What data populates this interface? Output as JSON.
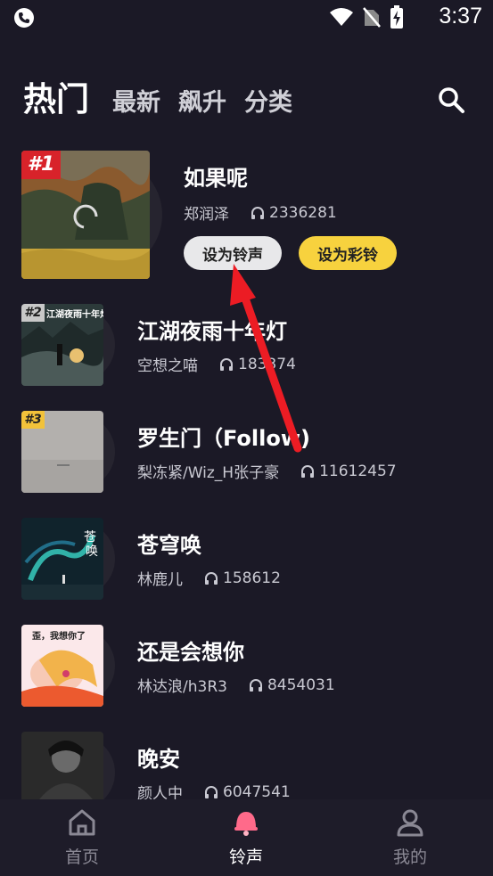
{
  "status": {
    "time": "3:37"
  },
  "header": {
    "tabs": [
      {
        "label": "热门"
      },
      {
        "label": "最新"
      },
      {
        "label": "飙升"
      },
      {
        "label": "分类"
      }
    ]
  },
  "list": [
    {
      "rank": "#1",
      "title": "如果呢",
      "artist": "郑润泽",
      "plays": "2336281",
      "ring_label": "设为铃声",
      "color_label": "设为彩铃"
    },
    {
      "rank": "#2",
      "title": "江湖夜雨十年灯",
      "artist": "空想之喵",
      "plays": "183374"
    },
    {
      "rank": "#3",
      "title": "罗生门（Follow)",
      "artist": "梨冻紧/Wiz_H张子豪",
      "plays": "11612457"
    },
    {
      "title": "苍穹唤",
      "artist": "林鹿儿",
      "plays": "158612"
    },
    {
      "title": "还是会想你",
      "artist": "林达浪/h3R3",
      "plays": "8454031"
    },
    {
      "title": "晚安",
      "artist": "颜人中",
      "plays": "6047541"
    }
  ],
  "tabbar": {
    "items": [
      {
        "label": "首页"
      },
      {
        "label": "铃声"
      },
      {
        "label": "我的"
      }
    ]
  },
  "colors": {
    "accent_active": "#ff6a8a",
    "button_yellow": "#f7d23e",
    "background": "#1b1926",
    "rank_badge_red": "#d8232a"
  },
  "cover_art": {
    "cover2_text": "江湖夜雨十年灯",
    "cover5_text": "歪，我想你了"
  }
}
